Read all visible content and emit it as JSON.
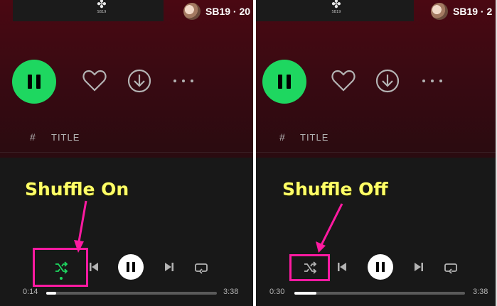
{
  "panels": [
    {
      "header": {
        "artist": "SB19 · 20",
        "logo_text": "SB19"
      },
      "tracklist": {
        "hash": "#",
        "title_col": "TITLE"
      },
      "annotation": "Shuffle On",
      "player": {
        "shuffle_state": "on",
        "current_time": "0:14",
        "total_time": "3:38",
        "progress_fraction": 0.06
      }
    },
    {
      "header": {
        "artist": "SB19 · 2",
        "logo_text": "SB19"
      },
      "tracklist": {
        "hash": "#",
        "title_col": "TITLE"
      },
      "annotation": "Shuffle Off",
      "player": {
        "shuffle_state": "off",
        "current_time": "0:30",
        "total_time": "3:38",
        "progress_fraction": 0.13
      }
    }
  ],
  "colors": {
    "accent": "#1ed760",
    "annotation": "#ffff66",
    "highlight": "#ff1aa1",
    "background": "#181818",
    "header": "#4a0812"
  },
  "icons": [
    "shuffle-icon",
    "previous-icon",
    "pause-icon",
    "next-icon",
    "repeat-icon",
    "heart-icon",
    "download-icon",
    "more-icon"
  ]
}
